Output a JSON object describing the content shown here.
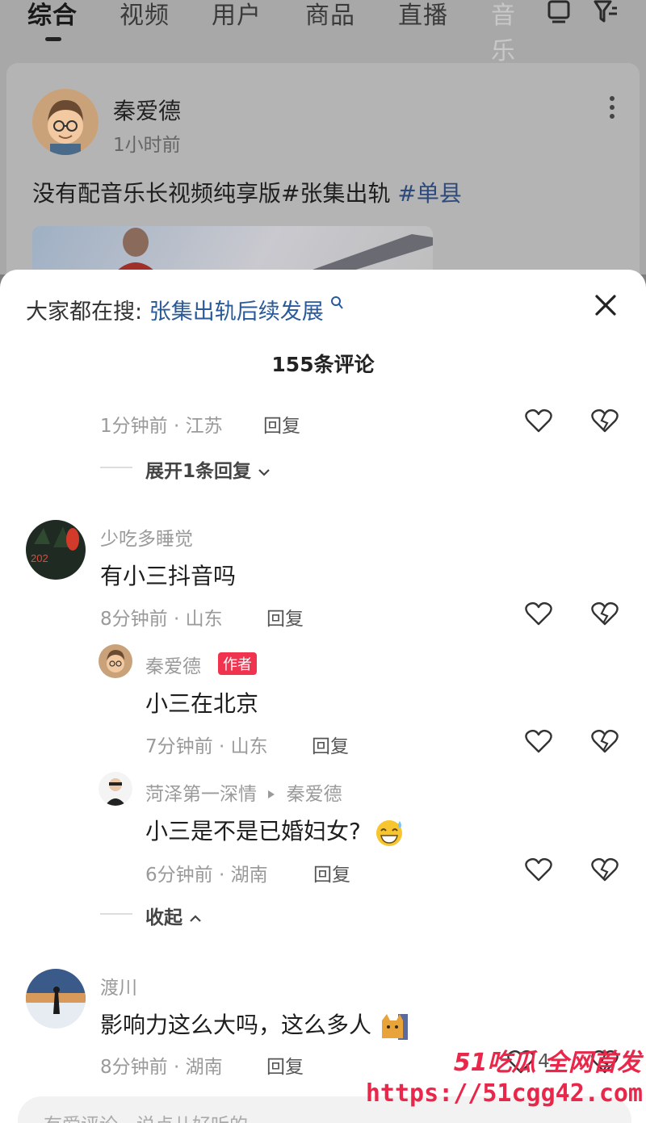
{
  "tabs": [
    {
      "label": "综合",
      "active": true
    },
    {
      "label": "视频",
      "active": false
    },
    {
      "label": "用户",
      "active": false
    },
    {
      "label": "商品",
      "active": false
    },
    {
      "label": "直播",
      "active": false
    },
    {
      "label": "音乐",
      "active": false
    }
  ],
  "top_icons": [
    "tv-icon",
    "filter-icon"
  ],
  "post": {
    "author": "秦爱德",
    "time": "1小时前",
    "text_prefix": "没有配音乐长视频纯享版#张集出轨",
    "hashtag": "#单县"
  },
  "sheet": {
    "search_prefix": "大家都在搜:",
    "search_term": "张集出轨后续发展",
    "search_icon": "search-icon",
    "comment_count": "155条评论",
    "close_icon": "close-icon"
  },
  "comments": {
    "partial": {
      "time_loc": "1分钟前 · 江苏",
      "reply_label": "回复",
      "expand_label": "展开1条回复"
    },
    "c1": {
      "user": "少吃多睡觉",
      "text": "有小三抖音吗",
      "time_loc": "8分钟前 · 山东",
      "reply_label": "回复"
    },
    "r1": {
      "user": "秦爱德",
      "badge": "作者",
      "text": "小三在北京",
      "time_loc": "7分钟前 · 山东",
      "reply_label": "回复"
    },
    "r2": {
      "user": "菏泽第一深情",
      "reply_to": "秦爱德",
      "text": "小三是不是已婚妇女?",
      "time_loc": "6分钟前 · 湖南",
      "reply_label": "回复"
    },
    "collapse_label": "收起",
    "c2": {
      "user": "渡川",
      "text": "影响力这么大吗，这么多人",
      "time_loc": "8分钟前 · 湖南",
      "reply_label": "回复",
      "like_count": "4"
    }
  },
  "input": {
    "placeholder": "有爱评论，说点儿好听的"
  },
  "watermark": {
    "brand": "51吃瓜 全网首发",
    "url": "https://51cgg42.com"
  },
  "colors": {
    "accent_link": "#2a5a9a",
    "badge": "#f0344f",
    "watermark": "#e8274a"
  }
}
